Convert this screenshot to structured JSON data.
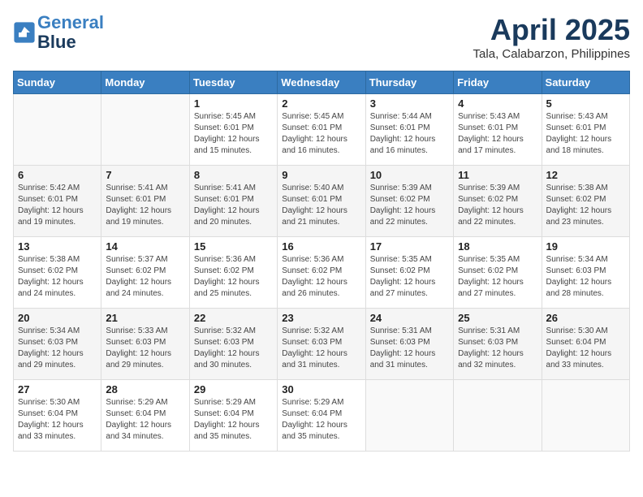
{
  "header": {
    "logo_line1": "General",
    "logo_line2": "Blue",
    "month_title": "April 2025",
    "location": "Tala, Calabarzon, Philippines"
  },
  "weekdays": [
    "Sunday",
    "Monday",
    "Tuesday",
    "Wednesday",
    "Thursday",
    "Friday",
    "Saturday"
  ],
  "weeks": [
    [
      {
        "day": "",
        "info": ""
      },
      {
        "day": "",
        "info": ""
      },
      {
        "day": "1",
        "info": "Sunrise: 5:45 AM\nSunset: 6:01 PM\nDaylight: 12 hours and 15 minutes."
      },
      {
        "day": "2",
        "info": "Sunrise: 5:45 AM\nSunset: 6:01 PM\nDaylight: 12 hours and 16 minutes."
      },
      {
        "day": "3",
        "info": "Sunrise: 5:44 AM\nSunset: 6:01 PM\nDaylight: 12 hours and 16 minutes."
      },
      {
        "day": "4",
        "info": "Sunrise: 5:43 AM\nSunset: 6:01 PM\nDaylight: 12 hours and 17 minutes."
      },
      {
        "day": "5",
        "info": "Sunrise: 5:43 AM\nSunset: 6:01 PM\nDaylight: 12 hours and 18 minutes."
      }
    ],
    [
      {
        "day": "6",
        "info": "Sunrise: 5:42 AM\nSunset: 6:01 PM\nDaylight: 12 hours and 19 minutes."
      },
      {
        "day": "7",
        "info": "Sunrise: 5:41 AM\nSunset: 6:01 PM\nDaylight: 12 hours and 19 minutes."
      },
      {
        "day": "8",
        "info": "Sunrise: 5:41 AM\nSunset: 6:01 PM\nDaylight: 12 hours and 20 minutes."
      },
      {
        "day": "9",
        "info": "Sunrise: 5:40 AM\nSunset: 6:01 PM\nDaylight: 12 hours and 21 minutes."
      },
      {
        "day": "10",
        "info": "Sunrise: 5:39 AM\nSunset: 6:02 PM\nDaylight: 12 hours and 22 minutes."
      },
      {
        "day": "11",
        "info": "Sunrise: 5:39 AM\nSunset: 6:02 PM\nDaylight: 12 hours and 22 minutes."
      },
      {
        "day": "12",
        "info": "Sunrise: 5:38 AM\nSunset: 6:02 PM\nDaylight: 12 hours and 23 minutes."
      }
    ],
    [
      {
        "day": "13",
        "info": "Sunrise: 5:38 AM\nSunset: 6:02 PM\nDaylight: 12 hours and 24 minutes."
      },
      {
        "day": "14",
        "info": "Sunrise: 5:37 AM\nSunset: 6:02 PM\nDaylight: 12 hours and 24 minutes."
      },
      {
        "day": "15",
        "info": "Sunrise: 5:36 AM\nSunset: 6:02 PM\nDaylight: 12 hours and 25 minutes."
      },
      {
        "day": "16",
        "info": "Sunrise: 5:36 AM\nSunset: 6:02 PM\nDaylight: 12 hours and 26 minutes."
      },
      {
        "day": "17",
        "info": "Sunrise: 5:35 AM\nSunset: 6:02 PM\nDaylight: 12 hours and 27 minutes."
      },
      {
        "day": "18",
        "info": "Sunrise: 5:35 AM\nSunset: 6:02 PM\nDaylight: 12 hours and 27 minutes."
      },
      {
        "day": "19",
        "info": "Sunrise: 5:34 AM\nSunset: 6:03 PM\nDaylight: 12 hours and 28 minutes."
      }
    ],
    [
      {
        "day": "20",
        "info": "Sunrise: 5:34 AM\nSunset: 6:03 PM\nDaylight: 12 hours and 29 minutes."
      },
      {
        "day": "21",
        "info": "Sunrise: 5:33 AM\nSunset: 6:03 PM\nDaylight: 12 hours and 29 minutes."
      },
      {
        "day": "22",
        "info": "Sunrise: 5:32 AM\nSunset: 6:03 PM\nDaylight: 12 hours and 30 minutes."
      },
      {
        "day": "23",
        "info": "Sunrise: 5:32 AM\nSunset: 6:03 PM\nDaylight: 12 hours and 31 minutes."
      },
      {
        "day": "24",
        "info": "Sunrise: 5:31 AM\nSunset: 6:03 PM\nDaylight: 12 hours and 31 minutes."
      },
      {
        "day": "25",
        "info": "Sunrise: 5:31 AM\nSunset: 6:03 PM\nDaylight: 12 hours and 32 minutes."
      },
      {
        "day": "26",
        "info": "Sunrise: 5:30 AM\nSunset: 6:04 PM\nDaylight: 12 hours and 33 minutes."
      }
    ],
    [
      {
        "day": "27",
        "info": "Sunrise: 5:30 AM\nSunset: 6:04 PM\nDaylight: 12 hours and 33 minutes."
      },
      {
        "day": "28",
        "info": "Sunrise: 5:29 AM\nSunset: 6:04 PM\nDaylight: 12 hours and 34 minutes."
      },
      {
        "day": "29",
        "info": "Sunrise: 5:29 AM\nSunset: 6:04 PM\nDaylight: 12 hours and 35 minutes."
      },
      {
        "day": "30",
        "info": "Sunrise: 5:29 AM\nSunset: 6:04 PM\nDaylight: 12 hours and 35 minutes."
      },
      {
        "day": "",
        "info": ""
      },
      {
        "day": "",
        "info": ""
      },
      {
        "day": "",
        "info": ""
      }
    ]
  ]
}
